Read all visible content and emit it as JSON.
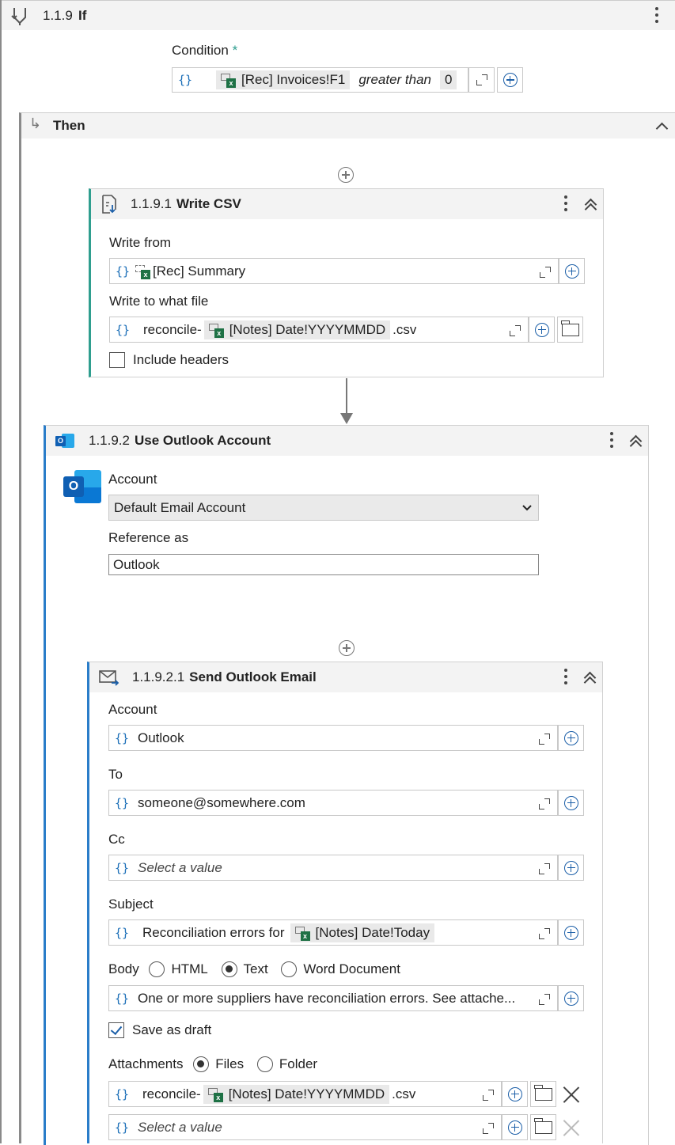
{
  "if_step": {
    "number": "1.1.9",
    "title": "If"
  },
  "condition": {
    "label": "Condition",
    "required_mark": "*",
    "variable": "[Rec] Invoices!F1",
    "operator": "greater than",
    "value": "0"
  },
  "then": {
    "label": "Then"
  },
  "write_csv": {
    "number": "1.1.9.1",
    "title": "Write CSV",
    "write_from": {
      "label": "Write from",
      "value": "[Rec] Summary"
    },
    "write_to": {
      "label": "Write to what file",
      "prefix": "reconcile-",
      "variable": "[Notes] Date!YYYYMMDD",
      "suffix": ".csv"
    },
    "include_headers": {
      "label": "Include headers",
      "checked": false
    }
  },
  "outlook_account": {
    "number": "1.1.9.2",
    "title": "Use Outlook Account",
    "account": {
      "label": "Account",
      "selected": "Default Email Account"
    },
    "reference": {
      "label": "Reference as",
      "value": "Outlook"
    }
  },
  "send_email": {
    "number": "1.1.9.2.1",
    "title": "Send Outlook Email",
    "account": {
      "label": "Account",
      "value": "Outlook"
    },
    "to": {
      "label": "To",
      "value": "someone@somewhere.com"
    },
    "cc": {
      "label": "Cc",
      "placeholder": "Select a value"
    },
    "subject": {
      "label": "Subject",
      "prefix": "Reconciliation errors for",
      "variable": "[Notes] Date!Today"
    },
    "body": {
      "label": "Body",
      "options": [
        "HTML",
        "Text",
        "Word Document"
      ],
      "selected": "Text",
      "value": "One or more suppliers have reconciliation errors. See attache..."
    },
    "save_as_draft": {
      "label": "Save as draft",
      "checked": true
    },
    "attachments": {
      "label": "Attachments",
      "options": [
        "Files",
        "Folder"
      ],
      "selected": "Files",
      "items": [
        {
          "prefix": "reconcile-",
          "variable": "[Notes] Date!YYYYMMDD",
          "suffix": ".csv"
        },
        {
          "placeholder": "Select a value"
        }
      ]
    }
  },
  "colors": {
    "accent_blue": "#1c5fa8",
    "excel_green": "#1e7145",
    "write_csv_accent": "#2f9e8f",
    "outlook_accent": "#2a7dc9"
  }
}
